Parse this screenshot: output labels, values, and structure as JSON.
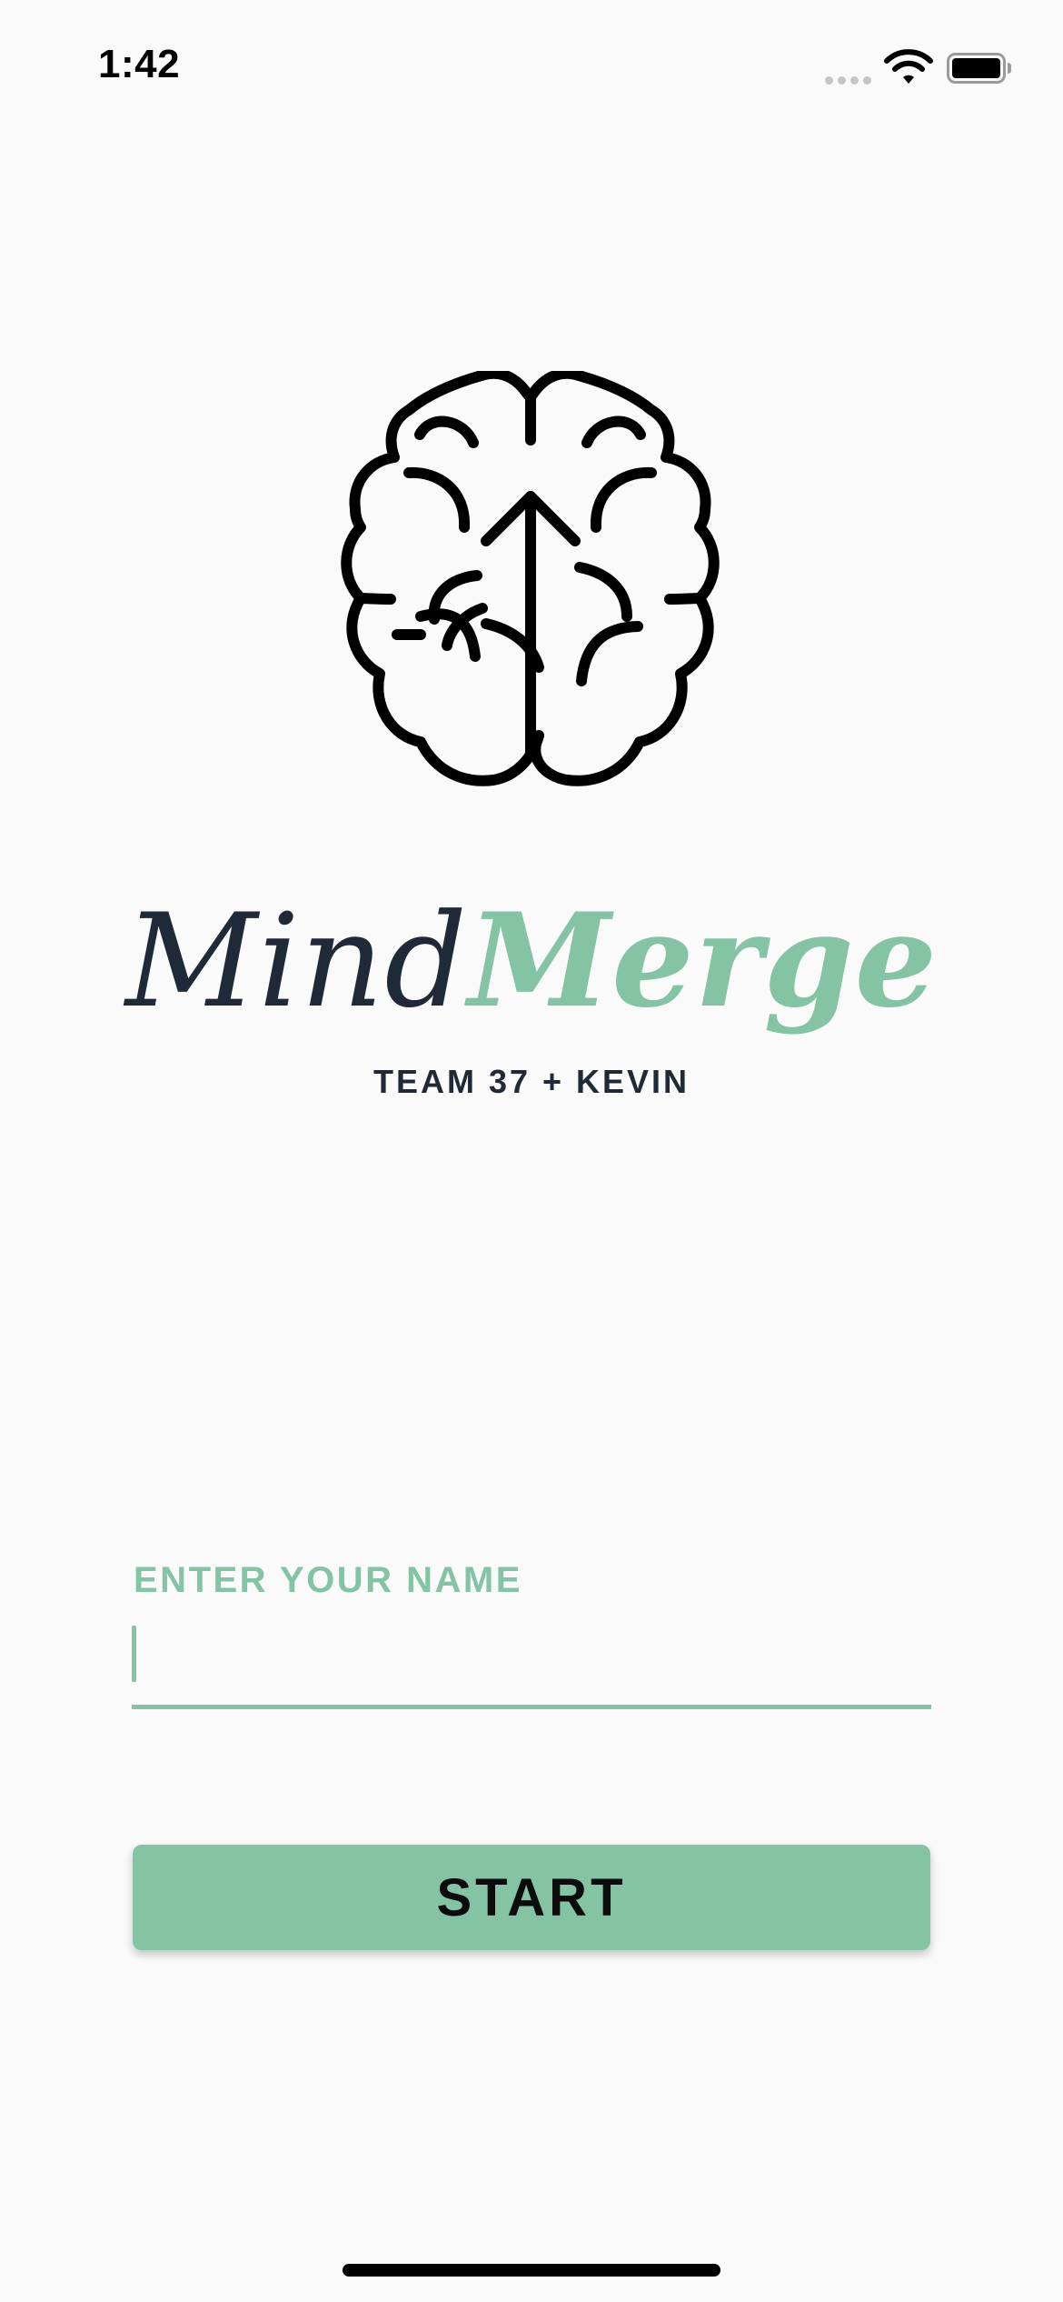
{
  "status_bar": {
    "time": "1:42",
    "icons": [
      "cellular-signal-icon",
      "wifi-icon",
      "battery-icon"
    ]
  },
  "logo": {
    "icon": "brain-arrow-icon",
    "title_part_1": "Mind",
    "title_part_2": "Merge",
    "subtitle": "TEAM 37 + KEVIN"
  },
  "form": {
    "name_label": "ENTER YOUR NAME",
    "name_value": "",
    "name_placeholder": "",
    "start_label": "START"
  },
  "colors": {
    "accent": "#84c3a3",
    "title_dark": "#1f2937",
    "background": "#fafafa",
    "button_text": "#0c0c0c"
  }
}
